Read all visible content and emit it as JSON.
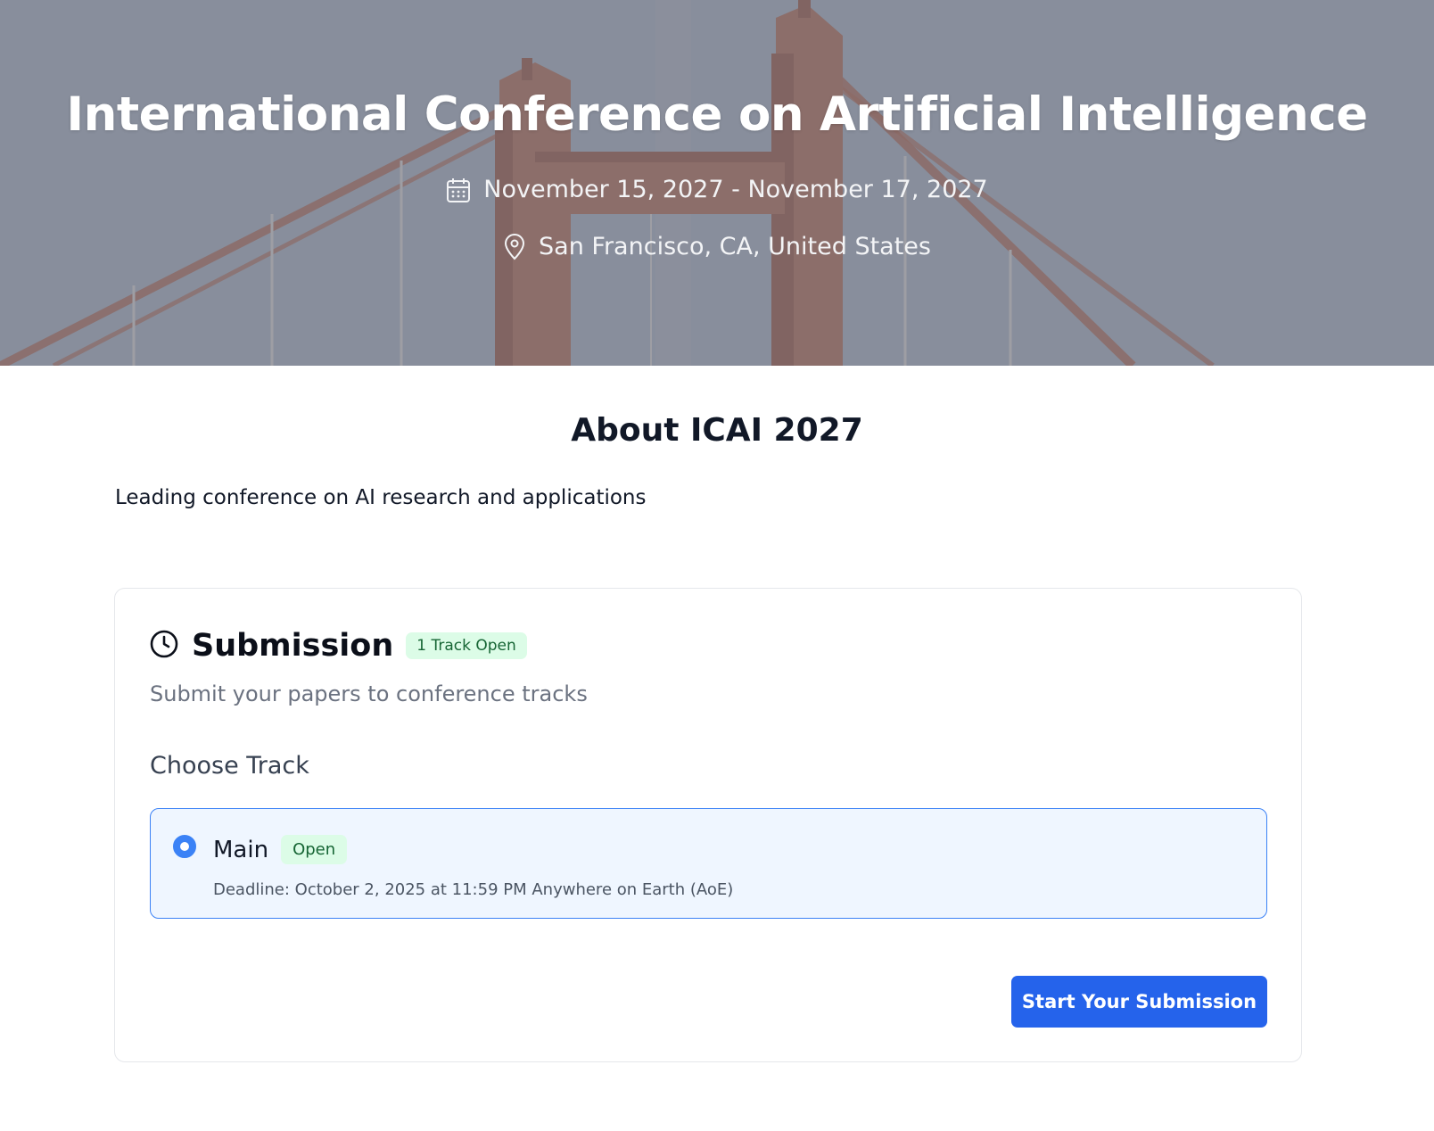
{
  "hero": {
    "title": "International Conference on Artificial Intelligence",
    "dates": "November 15, 2027 - November 17, 2027",
    "location": "San Francisco, CA, United States"
  },
  "about": {
    "title": "About ICAI 2027",
    "description": "Leading conference on AI research and applications"
  },
  "submission": {
    "title": "Submission",
    "badge": "1 Track Open",
    "subtitle": "Submit your papers to conference tracks",
    "choose_label": "Choose Track",
    "tracks": [
      {
        "name": "Main",
        "status": "Open",
        "deadline": "Deadline: October 2, 2025 at 11:59 PM Anywhere on Earth (AoE)",
        "selected": true
      }
    ],
    "button_label": "Start Your Submission"
  },
  "icons": {
    "date": "calendar-icon",
    "location": "map-pin-icon",
    "submission": "clock-icon"
  },
  "colors": {
    "primary": "#2563eb",
    "selected_border": "#3b82f6",
    "selected_bg": "#eff6ff",
    "badge_bg": "#dcfce7",
    "badge_text": "#166534"
  }
}
